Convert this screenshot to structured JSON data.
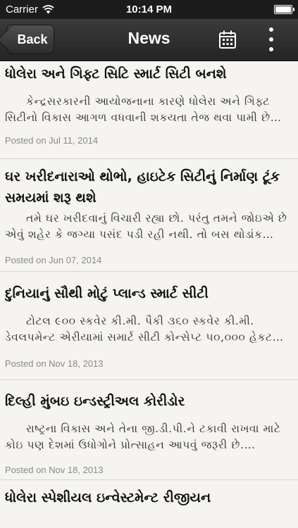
{
  "status_bar": {
    "carrier": "Carrier",
    "time": "10:14 PM",
    "wifi_icon": "wifi-icon",
    "battery_icon": "battery-icon"
  },
  "nav_bar": {
    "back_label": "Back",
    "title": "News",
    "calendar_icon": "calendar-icon",
    "more_icon": "more-vertical-icon",
    "background_color": "#2e2e2e"
  },
  "news": [
    {
      "title": "ધોલેરા અને ગિફ્ટ સિટિ સ્માર્ટ સિટી બનશે",
      "excerpt": "કેન્દ્રસરકારની આયોજનાના કારણે ધોલેરા અને ગિફ્ટ સિટીનો વિકાસ આગળ વધવાની શકયતા તેજ થવા પામી છે…",
      "date": "Posted on Jul 11, 2014"
    },
    {
      "title": "ઘર ખરીદનારાઓ થોભો, હાઇટેક સિટીનું નિર્માણ ટૂંક સમયમાં શરૂ થશે",
      "excerpt": "તમે ઘર ખરીદવાનું વિચારી રહ્યા છો. પરંતુ તમને જોઇએ છે એવું શહેર કે જગ્યા પસંદ પડી રહી નથી. તો બસ થોડાંક સમ…",
      "date": "Posted on Jun 07, 2014"
    },
    {
      "title": "દુનિયાનું સૌથી મોટું પ્લાન્ડ સ્માર્ટ સીટી",
      "excerpt": "ટોટલ ૯૦૦ સ્કવેર કી.મી. પૈકી ૩૬૦ સ્કવેર કી.મી. ડેવલપમેન્ટ એરીયામાં સમાર્ટ સીટી કોન્સેપ્ટ ૫૦,૦૦૦ હેકટ…",
      "date": "Posted on Nov 18, 2013"
    },
    {
      "title": "દિલ્હી મુંબઇ ઇન્ડસ્ટ્રીઅલ કોરીડોર",
      "excerpt": "રાષ્ટ્રના વિકાસ અને તેના જી.ડી.પી.ને ટકાવી રાખવા માટે કોઇ પણ દેશમાં ઉધોગોને પ્રોત્સાહન આપવું જરૂરી છે. ઉધોગોના…",
      "date": "Posted on Nov 18, 2013"
    },
    {
      "title": "ધોલેરા સ્પેશીયલ ઇન્વેસ્ટમેન્ટ રીજીયન"
    }
  ]
}
